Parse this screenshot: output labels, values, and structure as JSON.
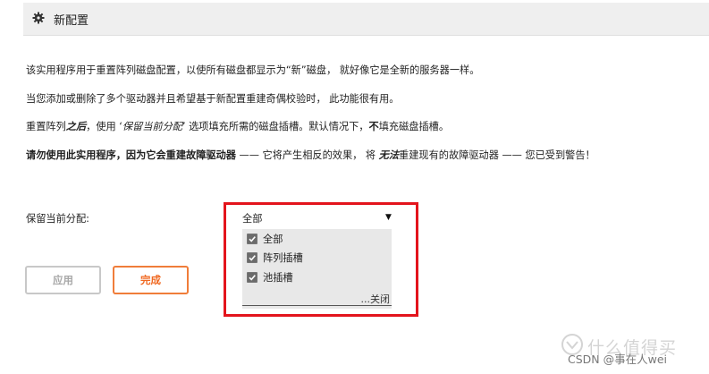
{
  "header": {
    "icon": "gear-icon",
    "title": "新配置"
  },
  "description": {
    "p1": "该实用程序用于重置阵列磁盘配置，以使所有磁盘都显示为“新”磁盘，  就好像它是全新的服务器一样。",
    "p2": "当您添加或删除了多个驱动器并且希望基于新配置重建奇偶校验时，   此功能很有用。",
    "p3": {
      "a": "重置阵列",
      "b": "之后",
      "c": "，使用 ‘",
      "d": "保留当前分配",
      "e": "’ 选项填充所需的磁盘插槽。默认情况下，",
      "f": "不",
      "g": "填充磁盘插槽。"
    },
    "p4": {
      "a": "请勿使用此实用程序，因为它会重建故障驱动器",
      "b": " —— 它将产生相反的效果，   将 ",
      "c": "无法",
      "d": "重建现有的故障驱动器 —— 您已受到警告！"
    }
  },
  "form": {
    "keep_label": "保留当前分配:",
    "select": {
      "value": "全部",
      "options": [
        {
          "label": "全部",
          "checked": true
        },
        {
          "label": "阵列插槽",
          "checked": true
        },
        {
          "label": "池插槽",
          "checked": true
        }
      ],
      "close_label": "...关闭"
    }
  },
  "buttons": {
    "apply": "应用",
    "done": "完成"
  },
  "watermark": {
    "text": "什么值得买",
    "csdn": "CSDN @事在人wei"
  },
  "colors": {
    "highlight": "#e3141c",
    "done_accent": "#f06a23",
    "header_bg": "#efefef"
  }
}
